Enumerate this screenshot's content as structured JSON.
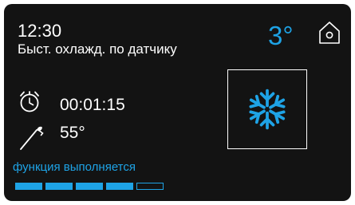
{
  "header": {
    "time": "12:30",
    "mode": "Быст. охлажд. по датчику",
    "temperature": "3°"
  },
  "timer": {
    "value": "00:01:15"
  },
  "probe": {
    "value": "55°"
  },
  "status": {
    "text": "функция выполняется"
  },
  "progress": {
    "filled": 4,
    "total": 5
  },
  "icons": {
    "home": "home-icon",
    "timer": "stopwatch-icon",
    "probe": "probe-icon",
    "function": "snowflake-icon"
  },
  "colors": {
    "accent": "#1ea3e6",
    "background": "#131313",
    "text": "#ffffff"
  }
}
